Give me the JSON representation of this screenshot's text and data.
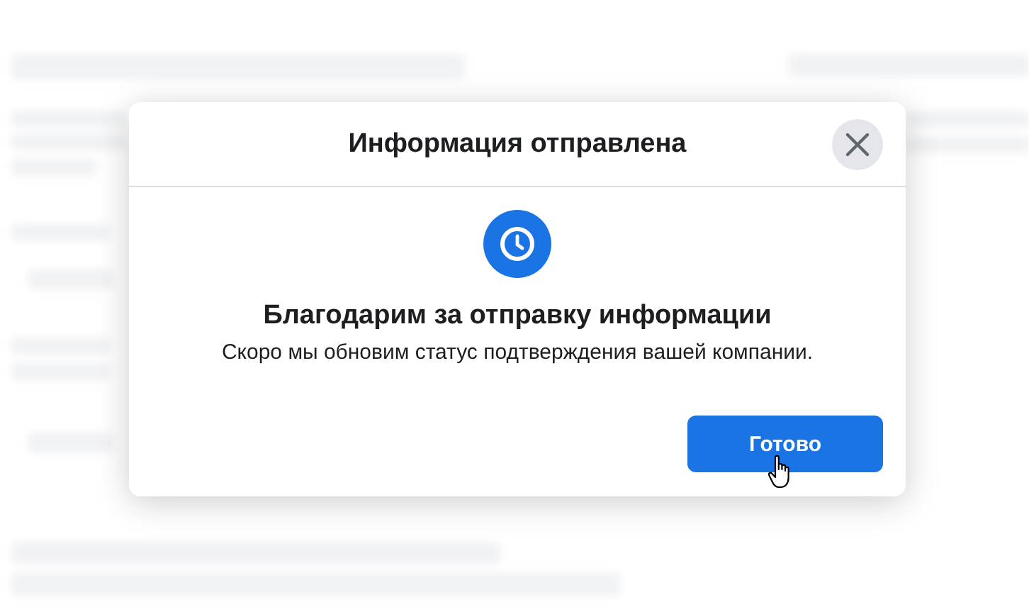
{
  "dialog": {
    "title": "Информация отправлена",
    "heading": "Благодарим за отправку информации",
    "message": "Скоро мы обновим статус подтверждения вашей компании.",
    "buttons": [
      {
        "label": "Готово",
        "kind": "primary"
      }
    ]
  }
}
